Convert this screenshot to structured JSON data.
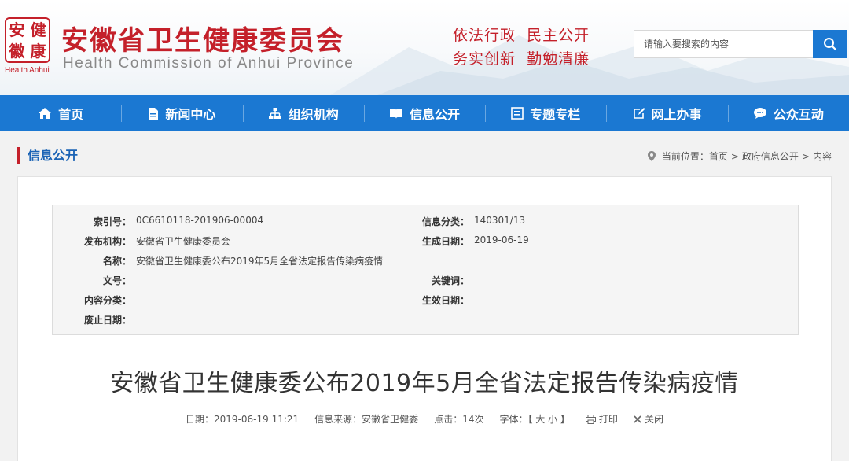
{
  "header": {
    "seal_chars": [
      "安",
      "健",
      "徽",
      "康"
    ],
    "seal_sub": "Health Anhui",
    "title": "安徽省卫生健康委员会",
    "subtitle": "Health Commission of Anhui Province",
    "motto_line1": "依法行政  民主公开",
    "motto_line2": "务实创新  勤勉清廉",
    "search_placeholder": "请输入要搜索的内容"
  },
  "nav": [
    {
      "label": "首页",
      "icon": "home-icon"
    },
    {
      "label": "新闻中心",
      "icon": "document-icon"
    },
    {
      "label": "组织机构",
      "icon": "org-chart-icon"
    },
    {
      "label": "信息公开",
      "icon": "book-icon"
    },
    {
      "label": "专题专栏",
      "icon": "list-icon"
    },
    {
      "label": "网上办事",
      "icon": "edit-icon"
    },
    {
      "label": "公众互动",
      "icon": "chat-icon"
    }
  ],
  "section": {
    "title": "信息公开",
    "breadcrumb": [
      "当前位置：首页",
      ">",
      "政府信息公开",
      ">",
      "内容"
    ]
  },
  "meta": {
    "index_label": "索引号：",
    "index_value": "0C6610118-201906-00004",
    "category_label": "信息分类：",
    "category_value": "140301/13",
    "publisher_label": "发布机构：",
    "publisher_value": "安徽省卫生健康委员会",
    "date_label": "生成日期：",
    "date_value": "2019-06-19",
    "name_label": "名称：",
    "name_value": "安徽省卫生健康委公布2019年5月全省法定报告传染病疫情",
    "docno_label": "文号：",
    "docno_value": "",
    "keywords_label": "关键词：",
    "keywords_value": "",
    "content_label": "内容分类：",
    "content_value": "",
    "effective_label": "生效日期：",
    "effective_value": "",
    "expire_label": "废止日期：",
    "expire_value": ""
  },
  "article": {
    "title": "安徽省卫生健康委公布2019年5月全省法定报告传染病疫情",
    "date": "日期：2019-06-19 11:21",
    "source": "信息来源：安徽省卫健委",
    "clicks": "点击：14次",
    "font_size": "字体：【 大 小 】",
    "print": "打印",
    "close": "关闭"
  },
  "colors": {
    "brand_red": "#c4202a",
    "nav_blue": "#1b78d2",
    "link_blue": "#1b63b5"
  }
}
